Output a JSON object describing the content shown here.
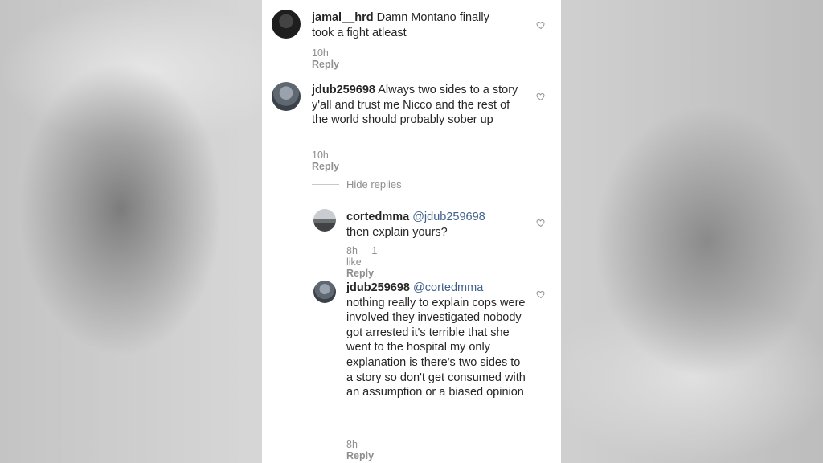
{
  "comments": [
    {
      "username": "jamal__hrd",
      "text": "Damn Montano finally took a fight atleast",
      "time": "10h",
      "reply_label": "Reply"
    },
    {
      "username": "jdub259698",
      "text": "Always two sides to a story y'all and trust me Nicco and the rest of the world should probably sober up",
      "time": "10h",
      "reply_label": "Reply"
    }
  ],
  "hide_replies_label": "Hide replies",
  "replies": [
    {
      "username": "cortedmma",
      "mention": "@jdub259698",
      "text": "then explain yours?",
      "time": "8h",
      "likes": "1 like",
      "reply_label": "Reply"
    },
    {
      "username": "jdub259698",
      "mention": "@cortedmma",
      "text": "nothing really to explain cops were involved they investigated nobody got arrested it's terrible that she went to the hospital my only explanation is there's two sides to a story so don't get consumed with an assumption or a biased opinion",
      "time": "8h",
      "reply_label": "Reply"
    }
  ]
}
